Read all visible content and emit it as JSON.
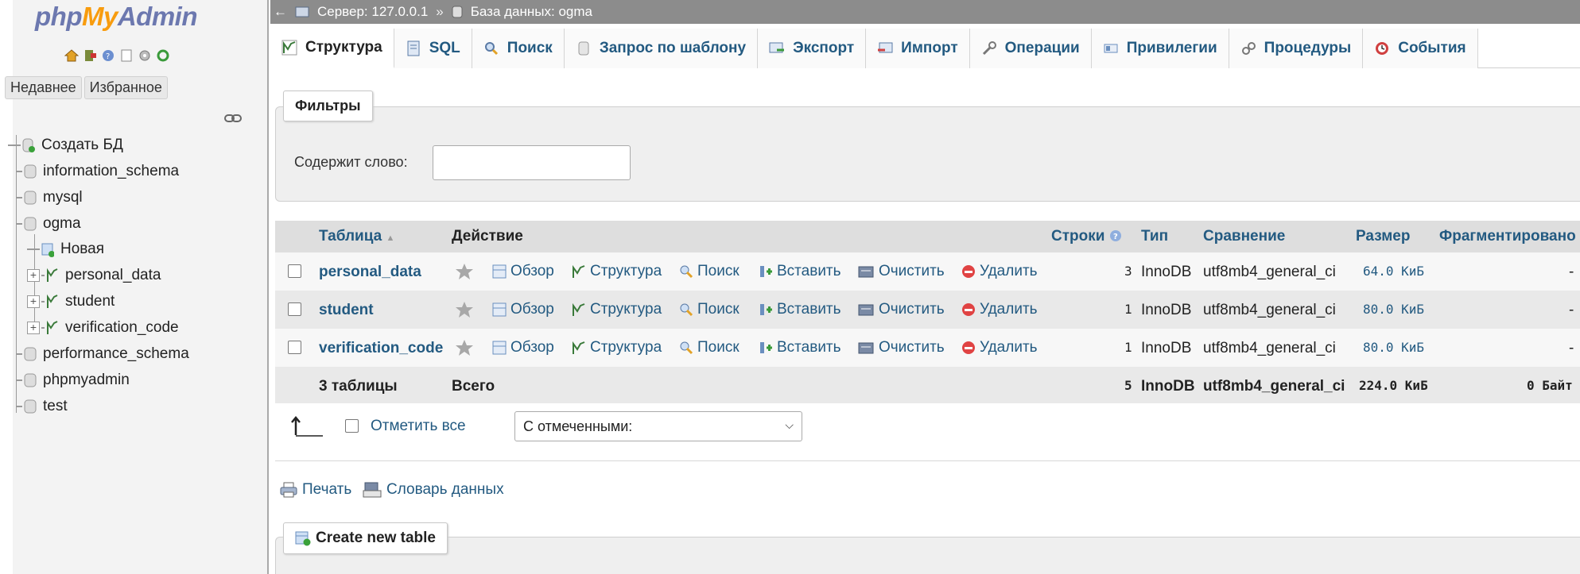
{
  "logo": {
    "php": "php",
    "my": "My",
    "admin": "Admin"
  },
  "nav": {
    "tabs": [
      "Недавнее",
      "Избранное"
    ],
    "tree": [
      {
        "label": "Создать БД",
        "level": 0
      },
      {
        "label": "information_schema",
        "level": 0
      },
      {
        "label": "mysql",
        "level": 0
      },
      {
        "label": "ogma",
        "level": 0
      },
      {
        "label": "Новая",
        "level": 1
      },
      {
        "label": "personal_data",
        "level": 1
      },
      {
        "label": "student",
        "level": 1
      },
      {
        "label": "verification_code",
        "level": 1
      },
      {
        "label": "performance_schema",
        "level": 0
      },
      {
        "label": "phpmyadmin",
        "level": 0
      },
      {
        "label": "test",
        "level": 0
      }
    ]
  },
  "breadcrumb": {
    "back": "←",
    "server": "Сервер: 127.0.0.1",
    "separator": "»",
    "database": "База данных: ogma"
  },
  "tabs": [
    {
      "label": "Структура",
      "icon": "structure-icon"
    },
    {
      "label": "SQL",
      "icon": "sql-icon"
    },
    {
      "label": "Поиск",
      "icon": "search-icon"
    },
    {
      "label": "Запрос по шаблону",
      "icon": "query-icon"
    },
    {
      "label": "Экспорт",
      "icon": "export-icon"
    },
    {
      "label": "Импорт",
      "icon": "import-icon"
    },
    {
      "label": "Операции",
      "icon": "wrench-icon"
    },
    {
      "label": "Привилегии",
      "icon": "privileges-icon"
    },
    {
      "label": "Процедуры",
      "icon": "routines-icon"
    },
    {
      "label": "События",
      "icon": "events-icon"
    }
  ],
  "filters": {
    "legend": "Фильтры",
    "label": "Содержит слово:",
    "value": ""
  },
  "table": {
    "headers": {
      "table": "Таблица",
      "sort_indicator": "▲",
      "action": "Действие",
      "rows": "Строки",
      "type": "Тип",
      "collation": "Сравнение",
      "size": "Размер",
      "overhead": "Фрагментировано"
    },
    "actions": [
      "Обзор",
      "Структура",
      "Поиск",
      "Вставить",
      "Очистить",
      "Удалить"
    ],
    "rows": [
      {
        "name": "personal_data",
        "rows": "3",
        "type": "InnoDB",
        "collation": "utf8mb4_general_ci",
        "size": "64.0 КиБ",
        "overhead": "-"
      },
      {
        "name": "student",
        "rows": "1",
        "type": "InnoDB",
        "collation": "utf8mb4_general_ci",
        "size": "80.0 КиБ",
        "overhead": "-"
      },
      {
        "name": "verification_code",
        "rows": "1",
        "type": "InnoDB",
        "collation": "utf8mb4_general_ci",
        "size": "80.0 КиБ",
        "overhead": "-"
      }
    ],
    "summary": {
      "name": "3 таблицы",
      "action": "Всего",
      "rows": "5",
      "type": "InnoDB",
      "collation": "utf8mb4_general_ci",
      "size": "224.0 КиБ",
      "overhead": "0 Байт"
    }
  },
  "bulk": {
    "check_all": "Отметить все",
    "with_selected": "С отмеченными:"
  },
  "links": {
    "print": "Печать",
    "data_dictionary": "Словарь данных"
  },
  "create_table": "Create new table",
  "colors": {
    "link": "#235a81",
    "logo_blue": "#6c78af",
    "logo_orange": "#f89c0e",
    "delete_red": "#e04343",
    "topbar": "#8c8c8c"
  }
}
